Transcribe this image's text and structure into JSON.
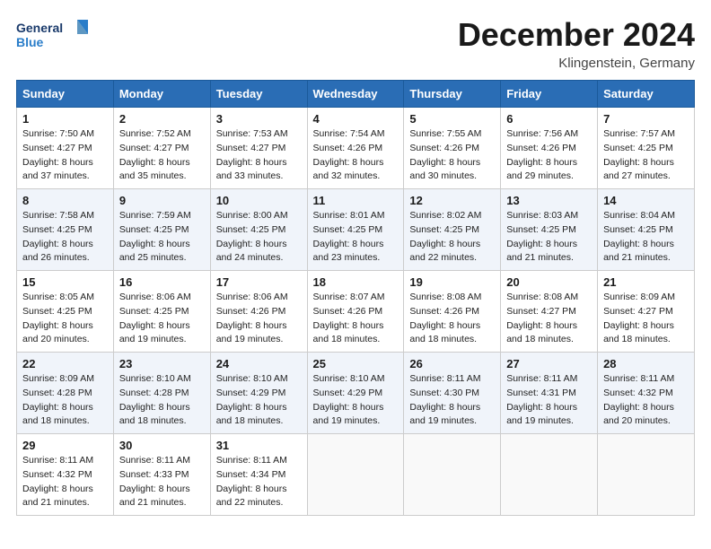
{
  "header": {
    "logo_line1": "General",
    "logo_line2": "Blue",
    "month_title": "December 2024",
    "subtitle": "Klingenstein, Germany"
  },
  "weekdays": [
    "Sunday",
    "Monday",
    "Tuesday",
    "Wednesday",
    "Thursday",
    "Friday",
    "Saturday"
  ],
  "weeks": [
    [
      {
        "day": "1",
        "sunrise": "7:50 AM",
        "sunset": "4:27 PM",
        "daylight": "8 hours and 37 minutes."
      },
      {
        "day": "2",
        "sunrise": "7:52 AM",
        "sunset": "4:27 PM",
        "daylight": "8 hours and 35 minutes."
      },
      {
        "day": "3",
        "sunrise": "7:53 AM",
        "sunset": "4:27 PM",
        "daylight": "8 hours and 33 minutes."
      },
      {
        "day": "4",
        "sunrise": "7:54 AM",
        "sunset": "4:26 PM",
        "daylight": "8 hours and 32 minutes."
      },
      {
        "day": "5",
        "sunrise": "7:55 AM",
        "sunset": "4:26 PM",
        "daylight": "8 hours and 30 minutes."
      },
      {
        "day": "6",
        "sunrise": "7:56 AM",
        "sunset": "4:26 PM",
        "daylight": "8 hours and 29 minutes."
      },
      {
        "day": "7",
        "sunrise": "7:57 AM",
        "sunset": "4:25 PM",
        "daylight": "8 hours and 27 minutes."
      }
    ],
    [
      {
        "day": "8",
        "sunrise": "7:58 AM",
        "sunset": "4:25 PM",
        "daylight": "8 hours and 26 minutes."
      },
      {
        "day": "9",
        "sunrise": "7:59 AM",
        "sunset": "4:25 PM",
        "daylight": "8 hours and 25 minutes."
      },
      {
        "day": "10",
        "sunrise": "8:00 AM",
        "sunset": "4:25 PM",
        "daylight": "8 hours and 24 minutes."
      },
      {
        "day": "11",
        "sunrise": "8:01 AM",
        "sunset": "4:25 PM",
        "daylight": "8 hours and 23 minutes."
      },
      {
        "day": "12",
        "sunrise": "8:02 AM",
        "sunset": "4:25 PM",
        "daylight": "8 hours and 22 minutes."
      },
      {
        "day": "13",
        "sunrise": "8:03 AM",
        "sunset": "4:25 PM",
        "daylight": "8 hours and 21 minutes."
      },
      {
        "day": "14",
        "sunrise": "8:04 AM",
        "sunset": "4:25 PM",
        "daylight": "8 hours and 21 minutes."
      }
    ],
    [
      {
        "day": "15",
        "sunrise": "8:05 AM",
        "sunset": "4:25 PM",
        "daylight": "8 hours and 20 minutes."
      },
      {
        "day": "16",
        "sunrise": "8:06 AM",
        "sunset": "4:25 PM",
        "daylight": "8 hours and 19 minutes."
      },
      {
        "day": "17",
        "sunrise": "8:06 AM",
        "sunset": "4:26 PM",
        "daylight": "8 hours and 19 minutes."
      },
      {
        "day": "18",
        "sunrise": "8:07 AM",
        "sunset": "4:26 PM",
        "daylight": "8 hours and 18 minutes."
      },
      {
        "day": "19",
        "sunrise": "8:08 AM",
        "sunset": "4:26 PM",
        "daylight": "8 hours and 18 minutes."
      },
      {
        "day": "20",
        "sunrise": "8:08 AM",
        "sunset": "4:27 PM",
        "daylight": "8 hours and 18 minutes."
      },
      {
        "day": "21",
        "sunrise": "8:09 AM",
        "sunset": "4:27 PM",
        "daylight": "8 hours and 18 minutes."
      }
    ],
    [
      {
        "day": "22",
        "sunrise": "8:09 AM",
        "sunset": "4:28 PM",
        "daylight": "8 hours and 18 minutes."
      },
      {
        "day": "23",
        "sunrise": "8:10 AM",
        "sunset": "4:28 PM",
        "daylight": "8 hours and 18 minutes."
      },
      {
        "day": "24",
        "sunrise": "8:10 AM",
        "sunset": "4:29 PM",
        "daylight": "8 hours and 18 minutes."
      },
      {
        "day": "25",
        "sunrise": "8:10 AM",
        "sunset": "4:29 PM",
        "daylight": "8 hours and 19 minutes."
      },
      {
        "day": "26",
        "sunrise": "8:11 AM",
        "sunset": "4:30 PM",
        "daylight": "8 hours and 19 minutes."
      },
      {
        "day": "27",
        "sunrise": "8:11 AM",
        "sunset": "4:31 PM",
        "daylight": "8 hours and 19 minutes."
      },
      {
        "day": "28",
        "sunrise": "8:11 AM",
        "sunset": "4:32 PM",
        "daylight": "8 hours and 20 minutes."
      }
    ],
    [
      {
        "day": "29",
        "sunrise": "8:11 AM",
        "sunset": "4:32 PM",
        "daylight": "8 hours and 21 minutes."
      },
      {
        "day": "30",
        "sunrise": "8:11 AM",
        "sunset": "4:33 PM",
        "daylight": "8 hours and 21 minutes."
      },
      {
        "day": "31",
        "sunrise": "8:11 AM",
        "sunset": "4:34 PM",
        "daylight": "8 hours and 22 minutes."
      },
      null,
      null,
      null,
      null
    ]
  ],
  "labels": {
    "sunrise": "Sunrise:",
    "sunset": "Sunset:",
    "daylight": "Daylight:"
  }
}
